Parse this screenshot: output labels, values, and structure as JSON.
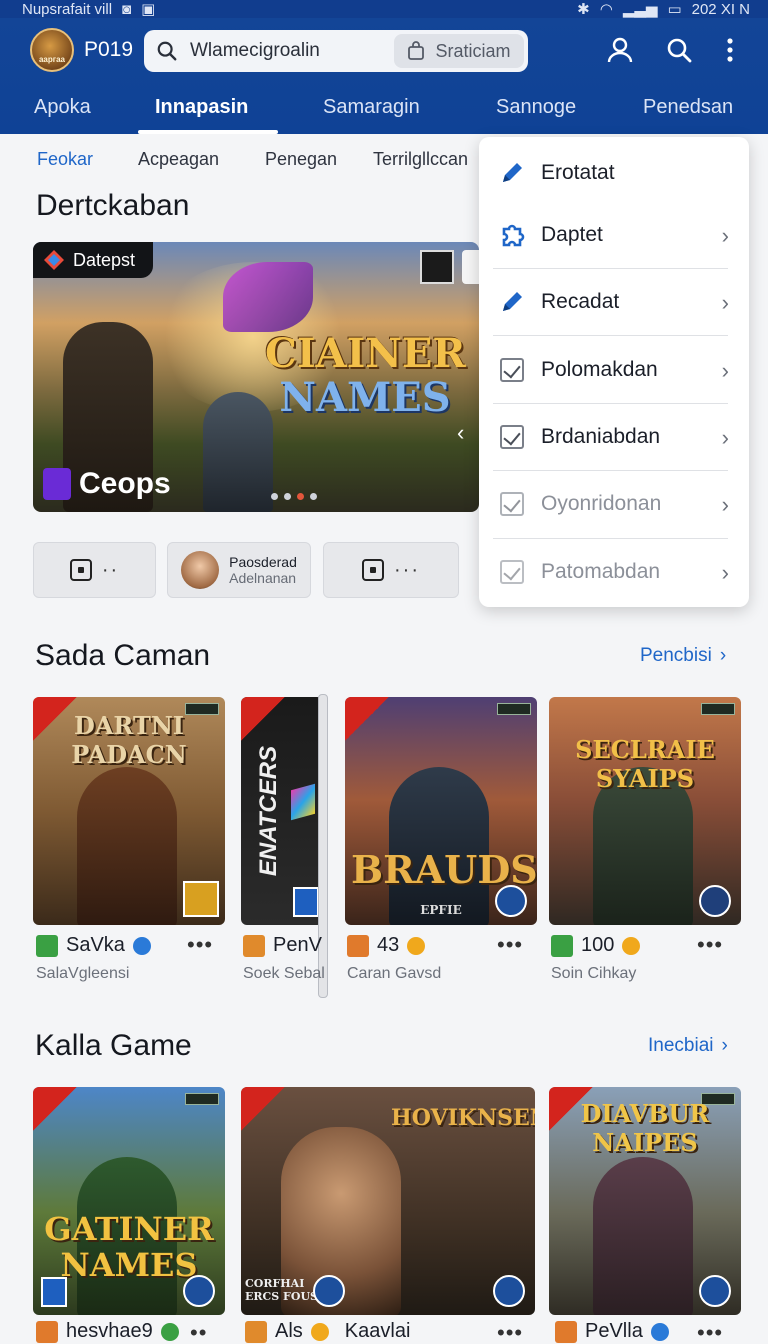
{
  "status_bar": {
    "left_text": "Nupsrafait vill",
    "right_text": "202 XI N"
  },
  "header": {
    "brand": "P019",
    "logo_text": "ааргаа",
    "search_value": "Wlamecigroalin",
    "search_chip": "Sraticiam",
    "icons": [
      "account-icon",
      "search-icon",
      "more-vert-icon"
    ]
  },
  "tabs": [
    {
      "label": "Apoka",
      "active": false
    },
    {
      "label": "Innapasin",
      "active": true
    },
    {
      "label": "Samaragin",
      "active": false
    },
    {
      "label": "Sannoge",
      "active": false
    },
    {
      "label": "Penedsan",
      "active": false
    }
  ],
  "subtabs": [
    {
      "label": "Feokar",
      "active": true
    },
    {
      "label": "Acpeagan",
      "active": false
    },
    {
      "label": "Penegan",
      "active": false
    },
    {
      "label": "Terrilgllccan",
      "active": false
    }
  ],
  "featured": {
    "section_title": "Dertckaban",
    "badge": "Datepst",
    "title_line1": "CIAINER",
    "title_line2": "NAMES",
    "brand": "Ceops",
    "dots": 4,
    "active_dot": 2
  },
  "chips": [
    {
      "type": "icon",
      "icon": "tablet-icon"
    },
    {
      "type": "profile",
      "title": "Paosderad",
      "subtitle": "Adelnanan"
    },
    {
      "type": "icon",
      "icon": "tablet-icon"
    }
  ],
  "dropdown": {
    "items": [
      {
        "label": "Erotatat",
        "icon": "pencil-icon",
        "chevron": false,
        "disabled": false
      },
      {
        "label": "Daptet",
        "icon": "puzzle-icon",
        "chevron": true,
        "disabled": false
      },
      {
        "label": "Recadat",
        "icon": "pencil-icon",
        "chevron": true,
        "disabled": false
      },
      {
        "label": "Polomakdan",
        "icon": "checkbox-icon",
        "chevron": true,
        "disabled": false
      },
      {
        "label": "Brdaniabdan",
        "icon": "checkbox-icon",
        "chevron": true,
        "disabled": false
      },
      {
        "label": "Oyonridonan",
        "icon": "checkbox-icon",
        "chevron": true,
        "disabled": true
      },
      {
        "label": "Patomabdan",
        "icon": "checkbox-icon",
        "chevron": true,
        "disabled": true
      }
    ]
  },
  "section1": {
    "title": "Sada Caman",
    "link": "Pencbisi",
    "games": [
      {
        "art_title": "DARTNI PADACN",
        "name": "SaVka",
        "sub": "SalaVgleensi",
        "icon_color": "#3aa043",
        "badge_color": "#2a7ad8"
      },
      {
        "art_title": "ENATCERS",
        "name": "PenV",
        "sub": "Soek Sebal",
        "icon_color": "#e08a2c",
        "badge_color": ""
      },
      {
        "art_title": "BRAUDS",
        "art_sub": "EPFIE",
        "name": "43",
        "sub": "Caran Gavsd",
        "icon_color": "#e07a2c",
        "badge_color": "#f0a81c"
      },
      {
        "art_title": "SECLRAIE SYAIPS",
        "name": "100",
        "sub": "Soin Cihkay",
        "icon_color": "#3aa043",
        "badge_color": "#f0a81c"
      }
    ]
  },
  "section2": {
    "title": "Kalla Game",
    "link": "Inecbiai",
    "games": [
      {
        "art_title": "GATINER NAMES",
        "name": "hesvhae9",
        "icon_color": "#e07a2c",
        "badge_color": "#3aa043"
      },
      {
        "art_title": "HOVIKNSEN",
        "art_sub": "CORFHAI ERCS FOUS",
        "name": "Als",
        "extra": "Kaavlai",
        "icon_color": "#e08a2c",
        "badge_color": "#f0a81c"
      },
      {
        "art_title": "DIAVBUR NAIPES",
        "name": "PeVlla",
        "icon_color": "#e07a2c",
        "badge_color": "#2a7ad8"
      }
    ]
  }
}
